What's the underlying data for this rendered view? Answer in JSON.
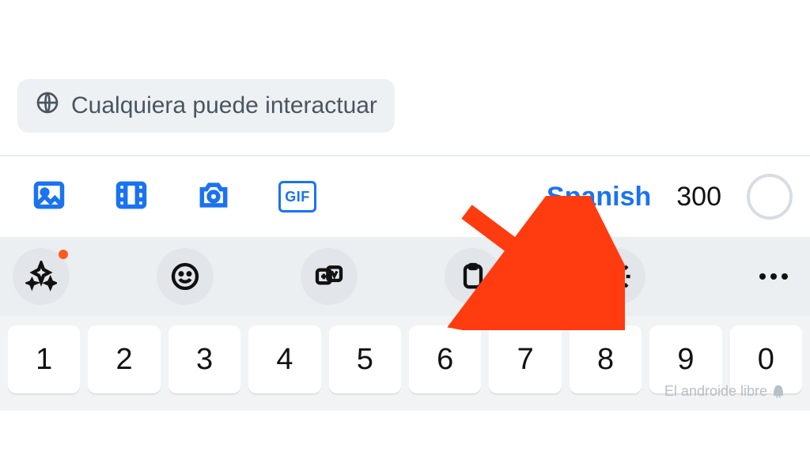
{
  "audience": {
    "globe_icon": "globe-icon",
    "label": "Cualquiera puede interactuar"
  },
  "compose": {
    "media_icon": "image-icon",
    "video_icon": "video-icon",
    "camera_icon": "camera-icon",
    "gif_label": "GIF",
    "language": "Spanish",
    "char_count": "300"
  },
  "suggestions": {
    "sparkle": "sparkle-icon",
    "emoji": "emoji-icon",
    "translate": "translate-icon",
    "clipboard": "clipboard-icon",
    "settings": "gear-icon",
    "has_new": true
  },
  "keys": [
    "1",
    "2",
    "3",
    "4",
    "5",
    "6",
    "7",
    "8",
    "9",
    "0"
  ],
  "watermark": "El androide libre"
}
